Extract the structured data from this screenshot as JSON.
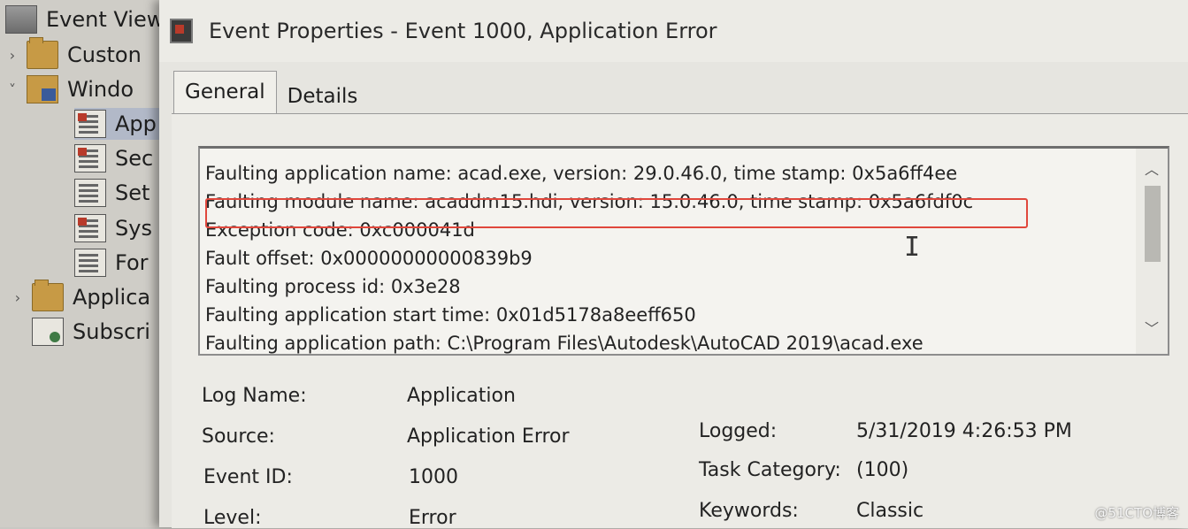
{
  "tree": {
    "items": [
      {
        "label": "Event View",
        "arrow": "",
        "icon": "event-viewer-icon"
      },
      {
        "label": "Custon",
        "arrow": "›",
        "icon": "folder-icon"
      },
      {
        "label": "Windo",
        "arrow": "˅",
        "icon": "windows-logs-icon"
      },
      {
        "label": "App",
        "arrow": "",
        "icon": "log-icon"
      },
      {
        "label": "Sec",
        "arrow": "",
        "icon": "log-icon"
      },
      {
        "label": "Set",
        "arrow": "",
        "icon": "log-icon"
      },
      {
        "label": "Sys",
        "arrow": "",
        "icon": "log-icon"
      },
      {
        "label": "For",
        "arrow": "",
        "icon": "log-icon"
      },
      {
        "label": "Applica",
        "arrow": "›",
        "icon": "folder-icon"
      },
      {
        "label": "Subscri",
        "arrow": "",
        "icon": "subscriptions-icon"
      }
    ]
  },
  "dialog": {
    "title": "Event Properties - Event 1000, Application Error",
    "tabs": [
      {
        "label": "General",
        "active": true
      },
      {
        "label": "Details",
        "active": false
      }
    ],
    "description_lines": [
      "Faulting application name: acad.exe, version: 29.0.46.0, time stamp: 0x5a6ff4ee",
      "Faulting module name: acaddm15.hdi, version: 15.0.46.0, time stamp: 0x5a6fdf0c",
      "Exception code: 0xc000041d",
      "Fault offset: 0x00000000000839b9",
      "Faulting process id: 0x3e28",
      "Faulting application start time: 0x01d5178a8eeff650",
      "Faulting application path: C:\\Program Files\\Autodesk\\AutoCAD 2019\\acad.exe"
    ],
    "highlighted_line_index": 1,
    "properties": {
      "log_name_label": "Log Name:",
      "log_name": "Application",
      "source_label": "Source:",
      "source": "Application Error",
      "logged_label": "Logged:",
      "logged": "5/31/2019 4:26:53 PM",
      "event_id_label": "Event ID:",
      "event_id": "1000",
      "task_category_label": "Task Category:",
      "task_category": "(100)",
      "level_label": "Level:",
      "level": "Error",
      "keywords_label": "Keywords:",
      "keywords": "Classic"
    }
  },
  "watermark": "@51CTO博客",
  "colors": {
    "highlight_border": "#e0473c",
    "dialog_background": "#e6e5e0"
  }
}
